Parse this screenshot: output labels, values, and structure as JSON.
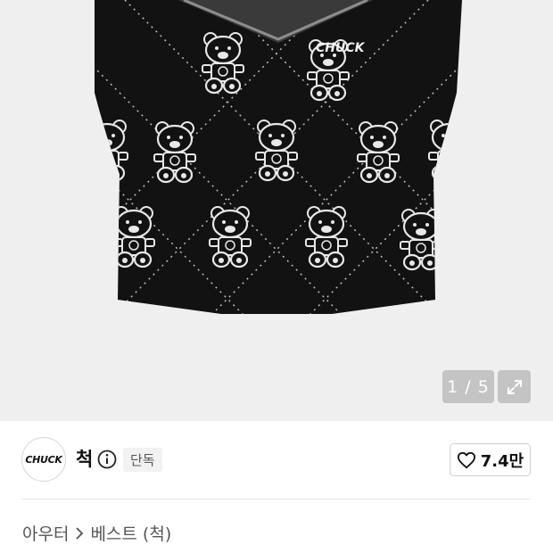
{
  "gallery": {
    "current_page": "1",
    "total_pages": "5",
    "image_subject": "black knit vest with bear pattern",
    "vest_logo_text": "CHUCK",
    "counter_text": "1 / 5"
  },
  "brand": {
    "logo_text": "CHUCK",
    "name": "척",
    "badge": "단독",
    "like_count": "7.4만"
  },
  "breadcrumb": {
    "category": "아우터",
    "subcategory": "베스트 (척)"
  },
  "icons": {
    "info": "info-icon",
    "expand": "expand-icon",
    "heart": "heart-icon",
    "chevron": "chevron-right-icon"
  },
  "colors": {
    "gallery_bg": "#efefef",
    "vest": "#121212",
    "counter_bg": "#a0a0a0"
  }
}
